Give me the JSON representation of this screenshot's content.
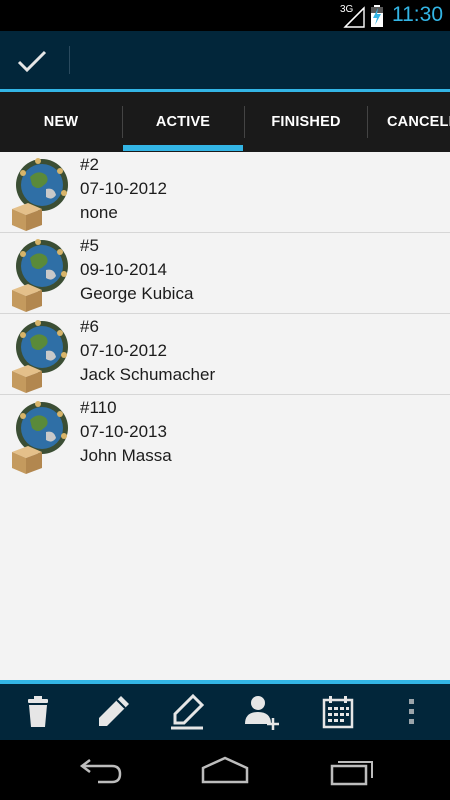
{
  "status_bar": {
    "network": "3G",
    "time": "11:30",
    "icons": [
      "signal-icon",
      "battery-charging-icon"
    ]
  },
  "action_bar": {
    "done_icon": "checkmark-icon"
  },
  "tabs": [
    {
      "label": "NEW",
      "selected": false
    },
    {
      "label": "ACTIVE",
      "selected": true
    },
    {
      "label": "FINISHED",
      "selected": false
    },
    {
      "label": "CANCELLED",
      "selected": false
    }
  ],
  "orders": [
    {
      "number": "#2",
      "date": "07-10-2012",
      "client": "none",
      "icon": "globe-package-icon"
    },
    {
      "number": "#5",
      "date": "09-10-2014",
      "client": "George Kubica",
      "icon": "globe-package-icon"
    },
    {
      "number": "#6",
      "date": "07-10-2012",
      "client": "Jack Schumacher",
      "icon": "globe-package-icon"
    },
    {
      "number": "#110",
      "date": "07-10-2013",
      "client": "John Massa",
      "icon": "globe-package-icon"
    }
  ],
  "bottom_actions": [
    "trash-icon",
    "pencil-icon",
    "edit-icon",
    "add-person-icon",
    "calendar-icon",
    "overflow-menu-icon"
  ],
  "nav_buttons": [
    "back-icon",
    "home-icon",
    "recent-apps-icon"
  ],
  "colors": {
    "accent": "#33b5e5",
    "action_bar": "#02263a",
    "tab_bar": "#1a1a1a",
    "list_bg": "#f3f3f3"
  }
}
